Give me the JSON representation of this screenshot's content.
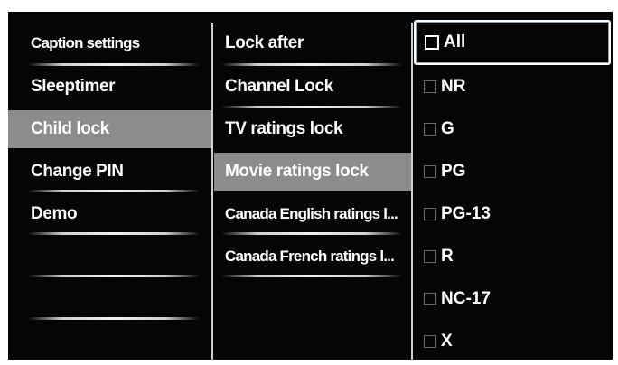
{
  "menu": {
    "items": [
      {
        "label": "Caption settings"
      },
      {
        "label": "Sleeptimer"
      },
      {
        "label": "Child lock",
        "selected": true
      },
      {
        "label": "Change PIN"
      },
      {
        "label": "Demo"
      }
    ]
  },
  "submenu": {
    "items": [
      {
        "label": "Lock after"
      },
      {
        "label": "Channel Lock"
      },
      {
        "label": "TV ratings lock"
      },
      {
        "label": "Movie ratings lock",
        "selected": true
      },
      {
        "label": "Canada English ratings l..."
      },
      {
        "label": "Canada French ratings l..."
      }
    ]
  },
  "ratings": {
    "items": [
      {
        "label": "All",
        "checked": false,
        "focused": true
      },
      {
        "label": "NR",
        "checked": false
      },
      {
        "label": "G",
        "checked": false
      },
      {
        "label": "PG",
        "checked": false
      },
      {
        "label": "PG-13",
        "checked": false
      },
      {
        "label": "R",
        "checked": false
      },
      {
        "label": "NC-17",
        "checked": false
      },
      {
        "label": "X",
        "checked": false
      }
    ]
  },
  "colors": {
    "background": "#050505",
    "selected_highlight": "#8c8c8c",
    "text": "#ffffff"
  }
}
